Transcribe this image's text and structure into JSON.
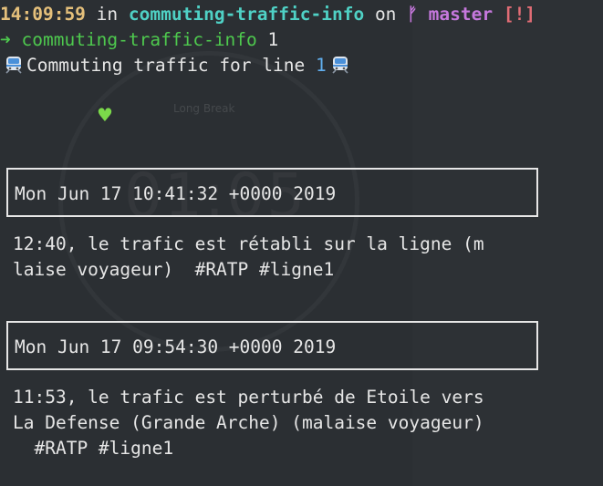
{
  "prompt": {
    "time": "14:09:59",
    "in_word": "in",
    "directory": "commuting-traffic-info",
    "on_word": "on",
    "branch_icon": "git-branch-icon",
    "branch_glyph": "ᚠ",
    "branch": "master",
    "git_status": "[!]"
  },
  "command": {
    "arrow": "➜",
    "directory": "commuting-traffic-info",
    "argument": "1"
  },
  "header": {
    "icon": "train-icon",
    "text": "Commuting traffic for line",
    "line_number": "1"
  },
  "background": {
    "label": "Long Break",
    "timer": "01:05",
    "heart_icon": "green-heart-icon",
    "heart_glyph": "♥"
  },
  "entries": [
    {
      "date": "Mon Jun 17 10:41:32 +0000 2019",
      "lines": [
        "12:40, le trafic est rétabli sur la ligne (m",
        "laise voyageur)  #RATP #ligne1"
      ]
    },
    {
      "date": "Mon Jun 17 09:54:30 +0000 2019",
      "lines": [
        "11:53, le trafic est perturbé de Etoile vers",
        "La Defense (Grande Arche) (malaise voyageur)",
        "  #RATP #ligne1"
      ]
    }
  ],
  "colors": {
    "background": "#2b2f33",
    "text": "#e6e6e6",
    "time": "#e5c07b",
    "directory": "#4fd1c5",
    "branch": "#c678dd",
    "status": "#e06c75",
    "arrow": "#4ec94e",
    "number": "#61afef"
  }
}
